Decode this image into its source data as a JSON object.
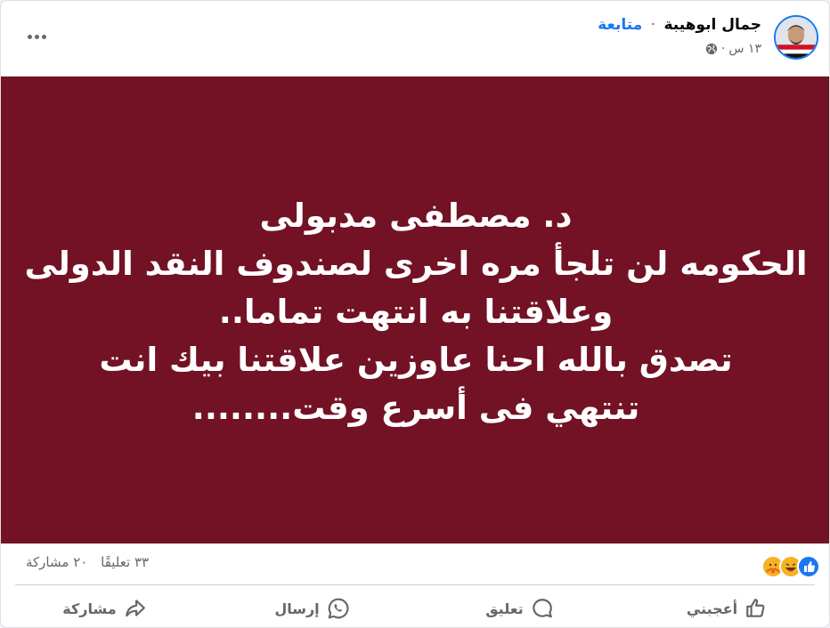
{
  "post": {
    "author": "جمال ابوهيبة",
    "follow_label": "متابعة",
    "separator": "·",
    "time": "١٣ س",
    "meta_separator": "·",
    "privacy_icon": "globe-icon",
    "more_icon": "more-horizontal-icon",
    "image_background": "#721224",
    "image_text_lines": [
      "د. مصطفى مدبولى",
      "الحكومه لن تلجأ مره اخرى لصندوف النقد الدولى",
      "وعلاقتنا به انتهت تماما..",
      "تصدق بالله احنا عاوزين علاقتنا بيك انت",
      "تنتهي فى أسرع وقت........"
    ]
  },
  "stats": {
    "reactions": [
      "like-icon",
      "haha-icon",
      "care-icon"
    ],
    "comments": "٣٣ تعليقًا",
    "shares": "٢٠ مشاركة"
  },
  "actions": {
    "like": "أعجبني",
    "comment": "تعليق",
    "send": "إرسال",
    "share": "مشاركة"
  },
  "colors": {
    "accent": "#1877f2",
    "secondary_text": "#65676b",
    "post_bg": "#721224"
  }
}
